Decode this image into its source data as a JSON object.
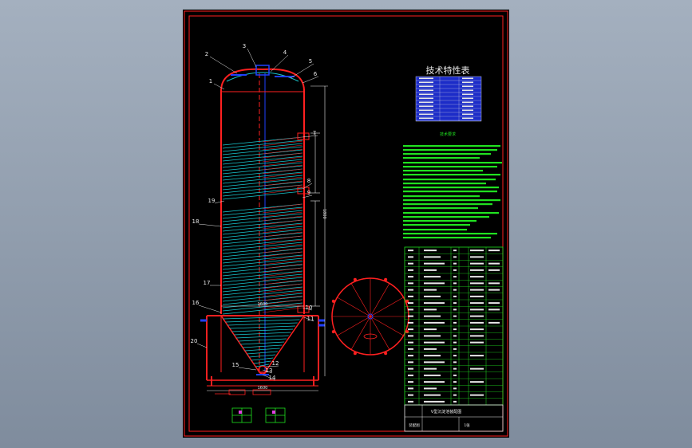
{
  "title_block": {
    "tech_table_title": "技术特性表",
    "notes_title": "技术要求",
    "drawing_name": "V型沉淀池装配图",
    "sheet_label": "装配图",
    "number_label": "1张"
  },
  "callouts": [
    "1",
    "2",
    "3",
    "4",
    "5",
    "6",
    "7",
    "8",
    "9",
    "10",
    "11",
    "12",
    "13",
    "14",
    "15",
    "16",
    "17",
    "18",
    "19",
    "20"
  ],
  "dimensions": {
    "shell_width": "1600",
    "cone_width": "1600",
    "mid_height": "1800"
  },
  "colors": {
    "frame": "#ff2020",
    "hatch": "#18c8d0",
    "table": "#20e020",
    "blue": "#2040ff",
    "white": "#e8e8e8"
  },
  "parts_list_rows": 24
}
